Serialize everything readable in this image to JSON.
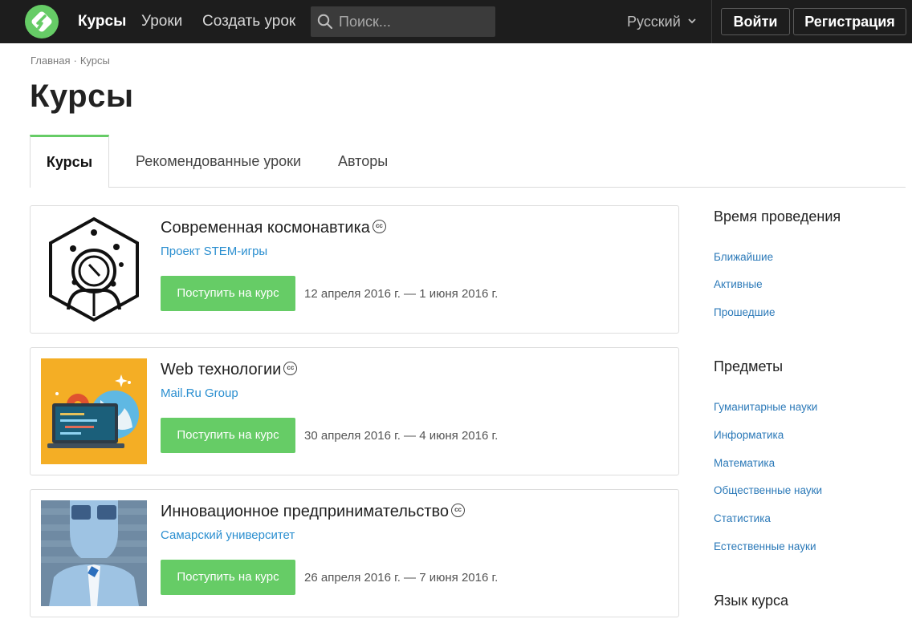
{
  "navbar": {
    "links": [
      "Курсы",
      "Уроки",
      "Создать урок"
    ],
    "search_placeholder": "Поиск...",
    "language": "Русский",
    "login": "Войти",
    "register": "Регистрация"
  },
  "breadcrumb": [
    "Главная",
    "Курсы"
  ],
  "page_title": "Курсы",
  "tabs": [
    "Курсы",
    "Рекомендованные уроки",
    "Авторы"
  ],
  "courses": [
    {
      "title": "Современная космонавтика",
      "cc": "cc",
      "author": "Проект STEM-игры",
      "button": "Поступить на курс",
      "dates": "12 апреля 2016 г. — 1 июня 2016 г."
    },
    {
      "title": "Web технологии",
      "cc": "cc",
      "author": "Mail.Ru Group",
      "button": "Поступить на курс",
      "dates": "30 апреля 2016 г. — 4 июня 2016 г."
    },
    {
      "title": "Инновационное предпринимательство",
      "cc": "cc",
      "author": "Самарский университет",
      "button": "Поступить на курс",
      "dates": "26 апреля 2016 г. — 7 июня 2016 г."
    }
  ],
  "sidebar": {
    "time_heading": "Время проведения",
    "time_links": [
      "Ближайшие",
      "Активные",
      "Прошедшие"
    ],
    "subjects_heading": "Предметы",
    "subject_links": [
      "Гуманитарные науки",
      "Информатика",
      "Математика",
      "Общественные науки",
      "Статистика",
      "Естественные науки"
    ],
    "language_heading": "Язык курса"
  },
  "colors": {
    "navbar_bg": "#1d1d1d",
    "accent_green": "#66cc66",
    "link_blue": "#2b8fd0"
  },
  "icons": {
    "logo": "stepik-logo",
    "search": "search-icon",
    "language": "chevron-down-icon",
    "license": "creative-commons-icon"
  }
}
